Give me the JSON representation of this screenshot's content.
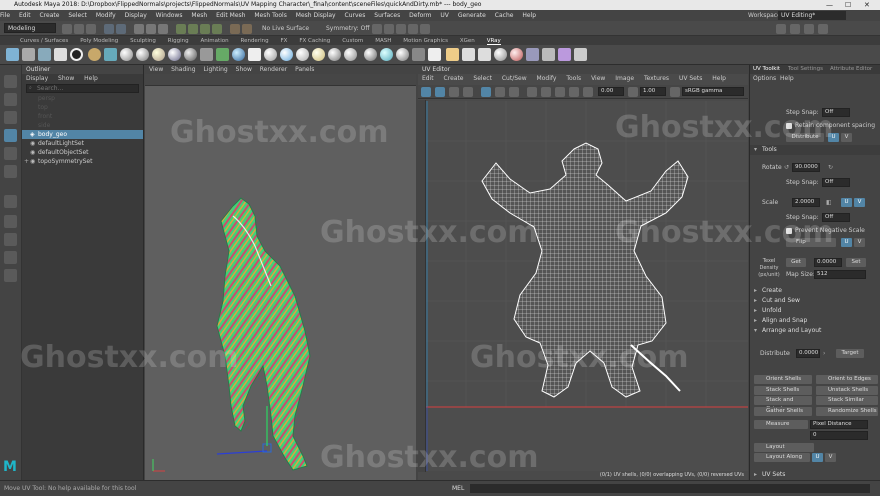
{
  "title": "Autodesk Maya 2018: D:\\Dropbox\\FlippedNormals\\projects\\FlippedNormals\\UV Mapping Character\\_final\\content\\sceneFiles\\quickAndDirty.mb* --- body_geo",
  "menus": [
    "File",
    "Edit",
    "Create",
    "Select",
    "Modify",
    "Display",
    "Windows",
    "Mesh",
    "Edit Mesh",
    "Mesh Tools",
    "Mesh Display",
    "Curves",
    "Surfaces",
    "Deform",
    "UV",
    "Generate",
    "Cache",
    "Help"
  ],
  "workspace": {
    "label": "Workspace:",
    "value": "UV Editing*"
  },
  "mode_dropdown": "Modeling",
  "live_surface": "No Live Surface",
  "symmetry": "Symmetry: Off",
  "shelf_tabs": [
    "Curves / Surfaces",
    "Poly Modeling",
    "Sculpting",
    "Rigging",
    "Animation",
    "Rendering",
    "FX",
    "FX Caching",
    "Custom",
    "MASH",
    "Motion Graphics",
    "XGen",
    "VRay"
  ],
  "outliner": {
    "title": "Outliner",
    "menu": [
      "Display",
      "Show",
      "Help"
    ],
    "search_placeholder": "Search...",
    "items": [
      "persp",
      "top",
      "front",
      "side",
      "body_geo",
      "defaultLightSet",
      "defaultObjectSet",
      "topoSymmetrySet"
    ],
    "selected_index": 4
  },
  "viewport": {
    "menu": [
      "View",
      "Shading",
      "Lighting",
      "Show",
      "Renderer",
      "Panels"
    ]
  },
  "uv_editor": {
    "title": "UV Editor",
    "menu": [
      "Edit",
      "Create",
      "Select",
      "Cut/Sew",
      "Modify",
      "Tools",
      "View",
      "Image",
      "Textures",
      "UV Sets",
      "Help"
    ],
    "value1": "0.00",
    "value2": "1.00",
    "colorspace": "sRGB gamma",
    "footer": "(0/1) UV shells, (0/0) overlapping UVs, (0/0) reversed UVs"
  },
  "toolkit": {
    "tabs": [
      "UV Toolkit",
      "Tool Settings",
      "Attribute Editor"
    ],
    "menu": [
      "Options",
      "Help"
    ],
    "step_snap_label": "Step Snap:",
    "step_snap_value": "Off",
    "retain_spacing": "Retain component spacing",
    "distribute_label": "Distribute",
    "tools_section": "Tools",
    "rotate_label": "Rotate",
    "rotate_value": "90.0000",
    "scale_label": "Scale",
    "scale_value": "2.0000",
    "prevent_negative": "Prevent Negative Scale",
    "flip_label": "Flip",
    "u": "U",
    "v": "V",
    "texel_label": "Texel Density (px/unit)",
    "get_label": "Get",
    "texel_value": "0.0000",
    "set_label": "Set",
    "map_size_label": "Map Size:",
    "map_size_value": "512",
    "sections": [
      "Create",
      "Cut and Sew",
      "Unfold",
      "Align and Snap",
      "Arrange and Layout"
    ],
    "distribute_value": "0.0000",
    "target_label": "Target",
    "buttons": [
      "Orient Shells",
      "Orient to Edges",
      "Stack Shells",
      "Unstack Shells",
      "Stack and Orient",
      "Stack Similar",
      "Gather Shells",
      "Randomize Shells"
    ],
    "measure_label": "Measure",
    "measure_value": "Pixel Distance",
    "measure_num": "0",
    "layout_label": "Layout",
    "layout_along_label": "Layout Along",
    "uv_sets": "UV Sets"
  },
  "status": {
    "left": "Move UV Tool: No help available for this tool",
    "mel": "MEL"
  },
  "watermark": "Ghostxx.com",
  "colors": {
    "accent": "#5285a6",
    "bg": "#444444",
    "uvline": "#ffffff"
  }
}
